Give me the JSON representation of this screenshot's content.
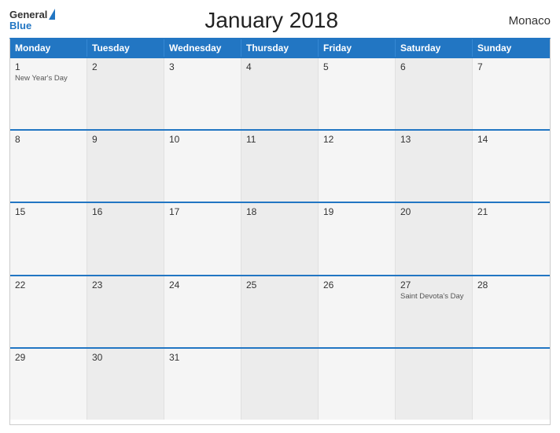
{
  "header": {
    "logo_general": "General",
    "logo_blue": "Blue",
    "title": "January 2018",
    "country": "Monaco"
  },
  "days_of_week": [
    "Monday",
    "Tuesday",
    "Wednesday",
    "Thursday",
    "Friday",
    "Saturday",
    "Sunday"
  ],
  "weeks": [
    [
      {
        "day": "1",
        "holiday": "New Year's Day"
      },
      {
        "day": "2",
        "holiday": ""
      },
      {
        "day": "3",
        "holiday": ""
      },
      {
        "day": "4",
        "holiday": ""
      },
      {
        "day": "5",
        "holiday": ""
      },
      {
        "day": "6",
        "holiday": ""
      },
      {
        "day": "7",
        "holiday": ""
      }
    ],
    [
      {
        "day": "8",
        "holiday": ""
      },
      {
        "day": "9",
        "holiday": ""
      },
      {
        "day": "10",
        "holiday": ""
      },
      {
        "day": "11",
        "holiday": ""
      },
      {
        "day": "12",
        "holiday": ""
      },
      {
        "day": "13",
        "holiday": ""
      },
      {
        "day": "14",
        "holiday": ""
      }
    ],
    [
      {
        "day": "15",
        "holiday": ""
      },
      {
        "day": "16",
        "holiday": ""
      },
      {
        "day": "17",
        "holiday": ""
      },
      {
        "day": "18",
        "holiday": ""
      },
      {
        "day": "19",
        "holiday": ""
      },
      {
        "day": "20",
        "holiday": ""
      },
      {
        "day": "21",
        "holiday": ""
      }
    ],
    [
      {
        "day": "22",
        "holiday": ""
      },
      {
        "day": "23",
        "holiday": ""
      },
      {
        "day": "24",
        "holiday": ""
      },
      {
        "day": "25",
        "holiday": ""
      },
      {
        "day": "26",
        "holiday": ""
      },
      {
        "day": "27",
        "holiday": "Saint Devota's Day"
      },
      {
        "day": "28",
        "holiday": ""
      }
    ],
    [
      {
        "day": "29",
        "holiday": ""
      },
      {
        "day": "30",
        "holiday": ""
      },
      {
        "day": "31",
        "holiday": ""
      },
      {
        "day": "",
        "holiday": ""
      },
      {
        "day": "",
        "holiday": ""
      },
      {
        "day": "",
        "holiday": ""
      },
      {
        "day": "",
        "holiday": ""
      }
    ]
  ]
}
